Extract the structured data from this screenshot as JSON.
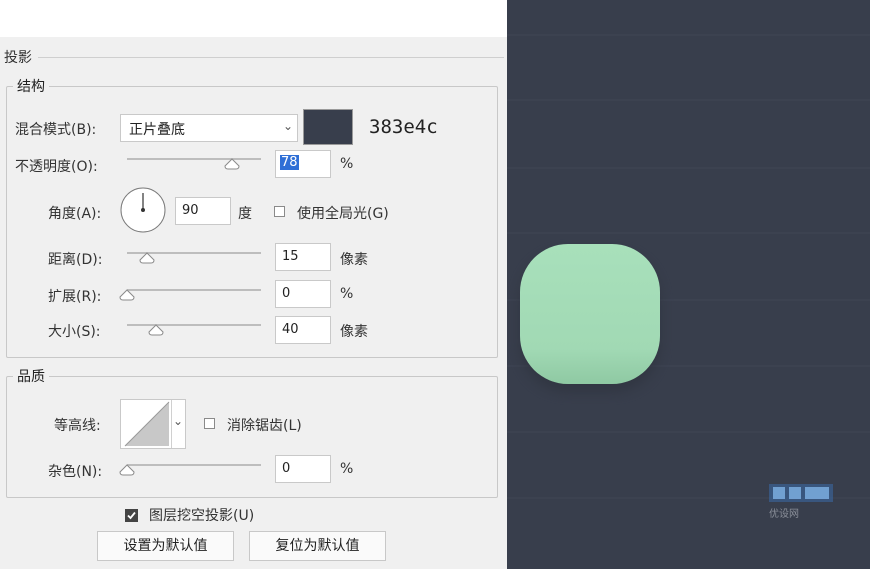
{
  "section_title": "投影",
  "structure": {
    "title": "结构",
    "blend_mode_label": "混合模式(B):",
    "blend_mode_value": "正片叠底",
    "shadow_color": "#383e4c",
    "color_annotation": "383e4c",
    "opacity_label": "不透明度(O):",
    "opacity_value": "78",
    "opacity_unit": "%",
    "opacity_level": 0.78,
    "angle_label": "角度(A):",
    "angle_value": "90",
    "angle_unit": "度",
    "global_light_label": "使用全局光(G)",
    "global_light_checked": false,
    "distance_label": "距离(D):",
    "distance_value": "15",
    "distance_unit": "像素",
    "spread_label": "扩展(R):",
    "spread_value": "0",
    "spread_unit": "%",
    "size_label": "大小(S):",
    "size_value": "40",
    "size_unit": "像素"
  },
  "quality": {
    "title": "品质",
    "contour_label": "等高线:",
    "anti_alias_label": "消除锯齿(L)",
    "anti_alias_checked": false,
    "noise_label": "杂色(N):",
    "noise_value": "0",
    "noise_unit": "%"
  },
  "knockout_label": "图层挖空投影(U)",
  "knockout_checked": true,
  "buttons": {
    "set_default": "设置为默认值",
    "reset_default": "复位为默认值"
  },
  "canvas": {
    "background": "#383e4c",
    "shape_color": "#a3dcb7",
    "watermark_text": "优设网"
  }
}
